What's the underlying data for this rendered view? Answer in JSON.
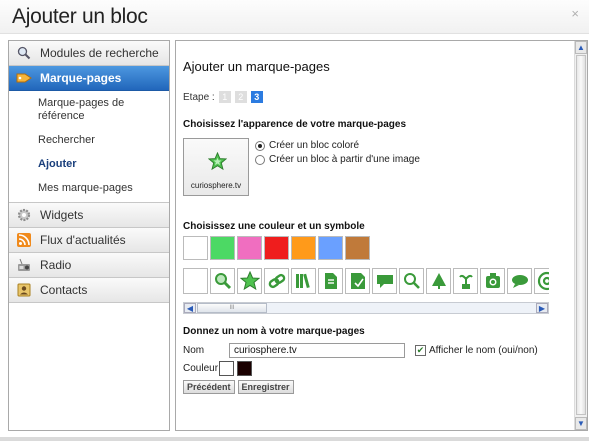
{
  "window": {
    "title": "Ajouter un bloc",
    "close_glyph": "×"
  },
  "sidebar": {
    "items": [
      {
        "label": "Modules de recherche",
        "icon": "search-icon"
      },
      {
        "label": "Marque-pages",
        "icon": "bookmark-tag-icon",
        "active": true
      },
      {
        "label": "Widgets",
        "icon": "gear-icon"
      },
      {
        "label": "Flux d'actualités",
        "icon": "rss-icon"
      },
      {
        "label": "Radio",
        "icon": "radio-icon"
      },
      {
        "label": "Contacts",
        "icon": "contacts-icon"
      }
    ],
    "subitems": [
      {
        "label": "Marque-pages de référence"
      },
      {
        "label": "Rechercher"
      },
      {
        "label": "Ajouter",
        "selected": true
      },
      {
        "label": "Mes marque-pages"
      }
    ]
  },
  "main": {
    "heading": "Ajouter un marque-pages",
    "steps_label": "Etape :",
    "steps": [
      "1",
      "2",
      "3"
    ],
    "current_step": "3",
    "appearance_heading": "Choisissez l'apparence de votre marque-pages",
    "preview_text": "curiosphere.tv",
    "appearance_options": [
      {
        "label": "Créer un bloc coloré",
        "checked": true
      },
      {
        "label": "Créer un bloc à partir d'une image",
        "checked": false
      }
    ],
    "color_heading": "Choisissez une couleur et un symbole",
    "color_swatches": [
      "#ffffff",
      "#4cd964",
      "#f06ec0",
      "#ef1d1d",
      "#ff9a1a",
      "#6aa0ff",
      "#c07a3a"
    ],
    "symbols": [
      "blank",
      "search-zoom-icon",
      "star-badge-icon",
      "chain-link-icon",
      "books-icon",
      "document-icon",
      "note-icon",
      "speech-bubble-icon",
      "magnifier-icon",
      "tree-icon",
      "plant-icon",
      "camera-icon",
      "cloud-bubble-icon",
      "at-sign-icon"
    ],
    "hscroll_thumb_text": "III",
    "name_heading": "Donnez un nom à votre marque-pages",
    "name_label": "Nom",
    "name_value": "curiosphere.tv",
    "show_name_label": "Afficher le nom (oui/non)",
    "show_name_checked": true,
    "color_label": "Couleur",
    "text_colors": [
      "#ffffff",
      "#1a0000"
    ],
    "back_button": "Précédent",
    "save_button": "Enregistrer"
  },
  "colors": {
    "accent": "#2c7be0",
    "active_nav": "#2166bb",
    "icon_green": "#3a9a3a"
  }
}
